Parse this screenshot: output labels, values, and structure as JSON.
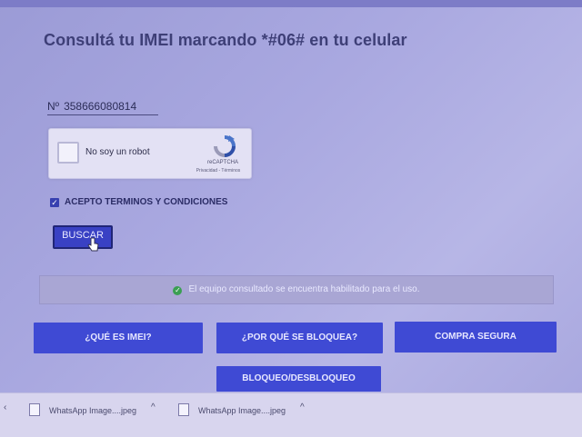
{
  "page": {
    "title": "Consultá tu IMEI marcando *#06# en tu celular"
  },
  "imei": {
    "prefix": "Nº",
    "value": "358666080814"
  },
  "recaptcha": {
    "label": "No soy un robot",
    "brand": "reCAPTCHA",
    "links": "Privacidad - Términos",
    "checked": false
  },
  "terms": {
    "label": "ACEPTO TERMINOS Y CONDICIONES",
    "checked": true
  },
  "search": {
    "label": "BUSCAR"
  },
  "status": {
    "message": "El equipo consultado se encuentra habilitado para el uso.",
    "color": "#3a9f52"
  },
  "nav": {
    "what_is_imei": "¿QUÉ ES IMEI?",
    "why_blocked": "¿POR QUÉ SE BLOQUEA?",
    "secure_purchase": "COMPRA SEGURA",
    "block_unblock": "BLOQUEO/DESBLOQUEO"
  },
  "downloads": {
    "items": [
      {
        "name": "WhatsApp Image....jpeg"
      },
      {
        "name": "WhatsApp Image....jpeg"
      }
    ]
  },
  "colors": {
    "button_blue": "#3f4ad4",
    "title": "#3e3f77"
  }
}
